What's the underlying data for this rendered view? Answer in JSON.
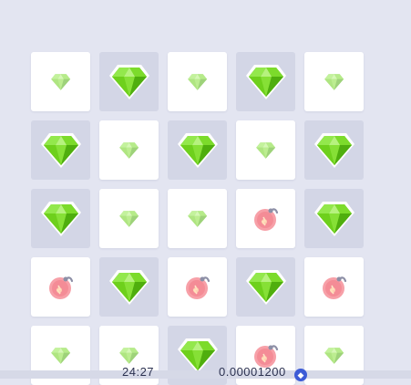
{
  "board": {
    "rows": [
      [
        "gem-small",
        "gem-large",
        "gem-small",
        "gem-large",
        "gem-small"
      ],
      [
        "gem-large",
        "gem-small",
        "gem-large",
        "gem-small",
        "gem-large"
      ],
      [
        "gem-large",
        "gem-small",
        "gem-small",
        "bomb",
        "gem-large"
      ],
      [
        "bomb",
        "gem-large",
        "bomb",
        "gem-large",
        "bomb"
      ],
      [
        "gem-small",
        "gem-small",
        "gem-large",
        "bomb",
        "gem-small"
      ]
    ]
  },
  "footer": {
    "left_text": "24:27",
    "right_text": "0.00001200",
    "currency_icon": "coin-icon"
  },
  "colors": {
    "background": "#e3e5f1",
    "tile_revealed": "#ffffff",
    "tile_hidden": "#d3d6e6",
    "gem": "#6ed01c",
    "gem_faded": "#bfe79a",
    "bomb": "#f79aa3"
  }
}
